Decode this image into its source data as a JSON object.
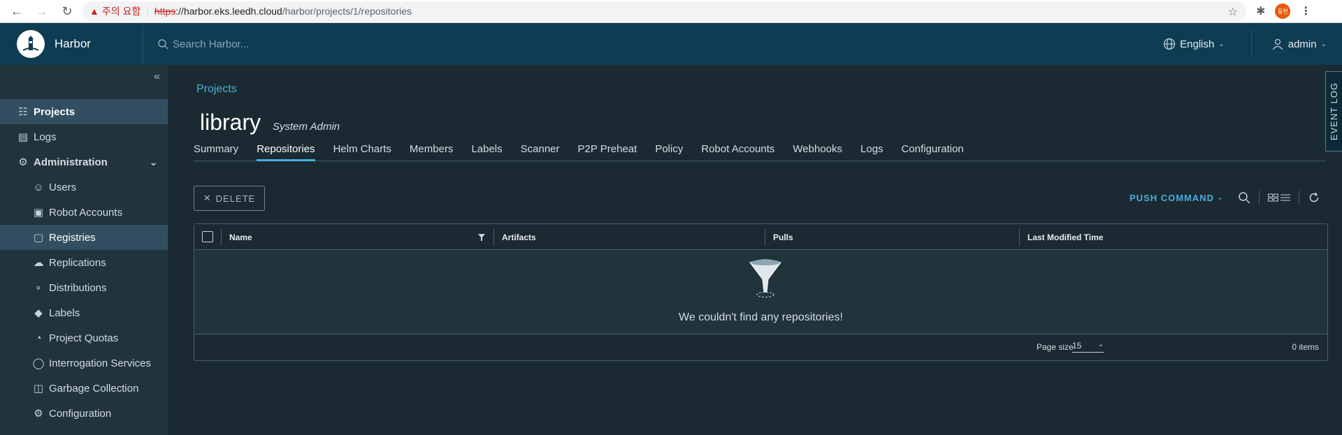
{
  "browser": {
    "warning_label": "주의 요함",
    "url_scheme": "https",
    "url_host": "://harbor.eks.leedh.cloud",
    "url_path": "/harbor/projects/1/repositories",
    "profile_initials": "동현"
  },
  "header": {
    "brand": "Harbor",
    "search_placeholder": "Search Harbor...",
    "language": "English",
    "user": "admin"
  },
  "sidebar": {
    "items": [
      {
        "label": "Projects",
        "icon": "projects-icon"
      },
      {
        "label": "Logs",
        "icon": "logs-icon"
      },
      {
        "label": "Administration",
        "icon": "administration-icon"
      },
      {
        "label": "Users",
        "icon": "users-icon"
      },
      {
        "label": "Robot Accounts",
        "icon": "robot-icon"
      },
      {
        "label": "Registries",
        "icon": "registries-icon"
      },
      {
        "label": "Replications",
        "icon": "replications-icon"
      },
      {
        "label": "Distributions",
        "icon": "distributions-icon"
      },
      {
        "label": "Labels",
        "icon": "labels-icon"
      },
      {
        "label": "Project Quotas",
        "icon": "quotas-icon"
      },
      {
        "label": "Interrogation Services",
        "icon": "shield-icon"
      },
      {
        "label": "Garbage Collection",
        "icon": "trash-icon"
      },
      {
        "label": "Configuration",
        "icon": "gear-icon"
      }
    ]
  },
  "main": {
    "breadcrumb": "Projects",
    "project_name": "library",
    "project_role": "System Admin",
    "tabs": [
      "Summary",
      "Repositories",
      "Helm Charts",
      "Members",
      "Labels",
      "Scanner",
      "P2P Preheat",
      "Policy",
      "Robot Accounts",
      "Webhooks",
      "Logs",
      "Configuration"
    ],
    "active_tab": "Repositories",
    "delete_label": "DELETE",
    "push_command_label": "PUSH COMMAND",
    "columns": [
      "Name",
      "Artifacts",
      "Pulls",
      "Last Modified Time"
    ],
    "empty_text": "We couldn't find any repositories!",
    "page_size_label": "Page size",
    "page_size_value": "15",
    "item_count": "0 items",
    "event_log_label": "EVENT LOG"
  },
  "colors": {
    "header_bg": "#0e3c53",
    "sidebar_bg": "#21333b",
    "content_bg": "#1b2a32",
    "accent": "#4aaed9",
    "active_nav": "#324f61"
  }
}
